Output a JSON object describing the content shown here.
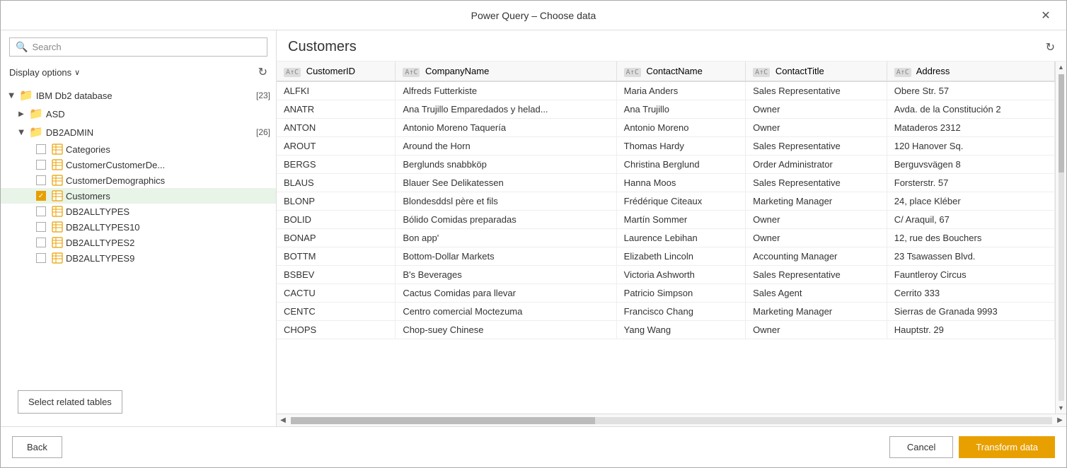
{
  "dialog": {
    "title": "Power Query – Choose data",
    "close_label": "✕"
  },
  "left_panel": {
    "search_placeholder": "Search",
    "display_options_label": "Display options",
    "chevron": "∨",
    "refresh_icon": "↻",
    "tree": [
      {
        "id": "ibm-db2",
        "indent": 0,
        "type": "folder",
        "expanded": true,
        "arrow": "▶",
        "label": "IBM Db2 database",
        "count": "[23]"
      },
      {
        "id": "asd",
        "indent": 1,
        "type": "folder",
        "expanded": false,
        "arrow": "▶",
        "label": "ASD",
        "count": ""
      },
      {
        "id": "db2admin",
        "indent": 1,
        "type": "folder",
        "expanded": true,
        "arrow": "▶",
        "label": "DB2ADMIN",
        "count": "[26]"
      },
      {
        "id": "categories",
        "indent": 2,
        "type": "table",
        "checked": false,
        "label": "Categories",
        "count": ""
      },
      {
        "id": "customercustomerde",
        "indent": 2,
        "type": "table",
        "checked": false,
        "label": "CustomerCustomerDe...",
        "count": ""
      },
      {
        "id": "customerdemographics",
        "indent": 2,
        "type": "table",
        "checked": false,
        "label": "CustomerDemographics",
        "count": ""
      },
      {
        "id": "customers",
        "indent": 2,
        "type": "table",
        "checked": true,
        "selected": true,
        "label": "Customers",
        "count": ""
      },
      {
        "id": "db2alltypes",
        "indent": 2,
        "type": "table",
        "checked": false,
        "label": "DB2ALLTYPES",
        "count": ""
      },
      {
        "id": "db2alltypes10",
        "indent": 2,
        "type": "table",
        "checked": false,
        "label": "DB2ALLTYPES10",
        "count": ""
      },
      {
        "id": "db2alltypes2",
        "indent": 2,
        "type": "table",
        "checked": false,
        "label": "DB2ALLTYPES2",
        "count": ""
      },
      {
        "id": "db2alltypes9",
        "indent": 2,
        "type": "table",
        "checked": false,
        "label": "DB2ALLTYPES9",
        "count": ""
      }
    ],
    "select_related_btn": "Select related tables"
  },
  "right_panel": {
    "table_title": "Customers",
    "refresh_icon": "↻",
    "columns": [
      {
        "type_label": "ABC",
        "name": "CustomerID"
      },
      {
        "type_label": "ABC",
        "name": "CompanyName"
      },
      {
        "type_label": "ABC",
        "name": "ContactName"
      },
      {
        "type_label": "ABC",
        "name": "ContactTitle"
      },
      {
        "type_label": "ABC",
        "name": "Address"
      }
    ],
    "rows": [
      [
        "ALFKI",
        "Alfreds Futterkiste",
        "Maria Anders",
        "Sales Representative",
        "Obere Str. 57"
      ],
      [
        "ANATR",
        "Ana Trujillo Emparedados y helad...",
        "Ana Trujillo",
        "Owner",
        "Avda. de la Constitución 2"
      ],
      [
        "ANTON",
        "Antonio Moreno Taquería",
        "Antonio Moreno",
        "Owner",
        "Mataderos 2312"
      ],
      [
        "AROUT",
        "Around the Horn",
        "Thomas Hardy",
        "Sales Representative",
        "120 Hanover Sq."
      ],
      [
        "BERGS",
        "Berglunds snabbköp",
        "Christina Berglund",
        "Order Administrator",
        "Berguvsvägen 8"
      ],
      [
        "BLAUS",
        "Blauer See Delikatessen",
        "Hanna Moos",
        "Sales Representative",
        "Forsterstr. 57"
      ],
      [
        "BLONP",
        "Blondesddsl père et fils",
        "Frédérique Citeaux",
        "Marketing Manager",
        "24, place Kléber"
      ],
      [
        "BOLID",
        "Bólido Comidas preparadas",
        "Martín Sommer",
        "Owner",
        "C/ Araquil, 67"
      ],
      [
        "BONAP",
        "Bon app'",
        "Laurence Lebihan",
        "Owner",
        "12, rue des Bouchers"
      ],
      [
        "BOTTM",
        "Bottom-Dollar Markets",
        "Elizabeth Lincoln",
        "Accounting Manager",
        "23 Tsawassen Blvd."
      ],
      [
        "BSBEV",
        "B's Beverages",
        "Victoria Ashworth",
        "Sales Representative",
        "Fauntleroy Circus"
      ],
      [
        "CACTU",
        "Cactus Comidas para llevar",
        "Patricio Simpson",
        "Sales Agent",
        "Cerrito 333"
      ],
      [
        "CENTC",
        "Centro comercial Moctezuma",
        "Francisco Chang",
        "Marketing Manager",
        "Sierras de Granada 9993"
      ],
      [
        "CHOPS",
        "Chop-suey Chinese",
        "Yang Wang",
        "Owner",
        "Hauptstr. 29"
      ]
    ]
  },
  "bottom_bar": {
    "back_label": "Back",
    "cancel_label": "Cancel",
    "transform_label": "Transform data"
  }
}
